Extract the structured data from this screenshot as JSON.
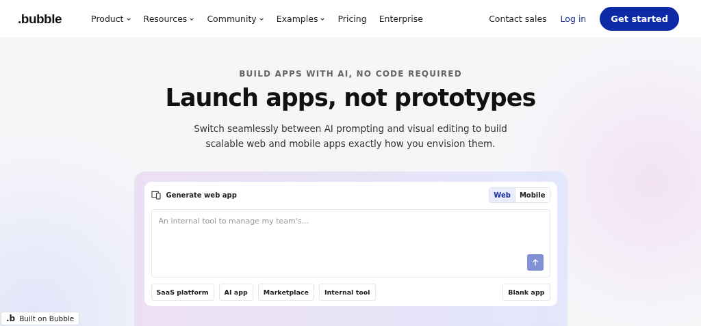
{
  "header": {
    "logo": ".bubble",
    "nav": [
      {
        "label": "Product",
        "dropdown": true
      },
      {
        "label": "Resources",
        "dropdown": true
      },
      {
        "label": "Community",
        "dropdown": true
      },
      {
        "label": "Examples",
        "dropdown": true
      },
      {
        "label": "Pricing",
        "dropdown": false
      },
      {
        "label": "Enterprise",
        "dropdown": false
      }
    ],
    "contact": "Contact sales",
    "login": "Log in",
    "cta": "Get started"
  },
  "hero": {
    "eyebrow": "BUILD APPS WITH AI, NO CODE REQUIRED",
    "title": "Launch apps, not prototypes",
    "subtitle": "Switch seamlessly between AI prompting and visual editing to build scalable web and mobile apps exactly how you envision them."
  },
  "generator": {
    "label": "Generate web app",
    "tabs": [
      {
        "label": "Web",
        "selected": true
      },
      {
        "label": "Mobile",
        "selected": false
      }
    ],
    "prompt": {
      "placeholder": "An internal tool to manage my team's..."
    },
    "chips": [
      "SaaS platform",
      "AI app",
      "Marketplace",
      "Internal tool"
    ],
    "blank": "Blank app"
  },
  "badge": {
    "logo": ".b",
    "label": "Built on Bubble"
  }
}
